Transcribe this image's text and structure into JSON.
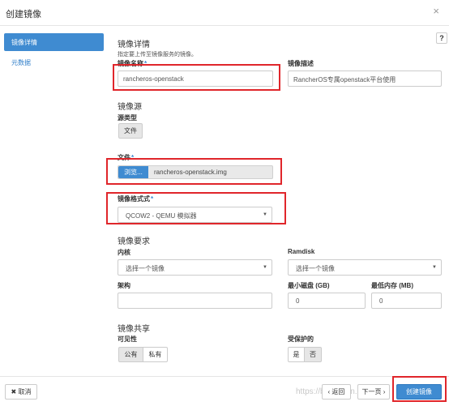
{
  "dialog": {
    "title": "创建镜像",
    "close_icon": "×"
  },
  "sidebar": {
    "items": [
      {
        "label": "镜像详情",
        "active": true
      },
      {
        "label": "元数据",
        "active": false
      }
    ]
  },
  "help_icon": "?",
  "details": {
    "section_title": "镜像详情",
    "hint": "指定要上传至镜像服务的镜像。",
    "name_label": "镜像名称",
    "name_value": "rancheros-openstack",
    "desc_label": "镜像描述",
    "desc_value": "RancherOS专属openstack平台使用"
  },
  "source": {
    "section_title": "镜像源",
    "type_label": "源类型",
    "type_button": "文件",
    "file_label": "文件",
    "browse_label": "浏览...",
    "file_name": "rancheros-openstack.img",
    "format_label": "镜像格式式",
    "format_value": "QCOW2 - QEMU 模拟器"
  },
  "requirements": {
    "section_title": "镜像要求",
    "kernel_label": "内核",
    "kernel_placeholder": "选择一个镜像",
    "ramdisk_label": "Ramdisk",
    "ramdisk_placeholder": "选择一个镜像",
    "arch_label": "架构",
    "arch_value": "",
    "min_disk_label": "最小磁盘 (GB)",
    "min_disk_value": "0",
    "min_ram_label": "最低内存 (MB)",
    "min_ram_value": "0"
  },
  "sharing": {
    "section_title": "镜像共享",
    "visibility_label": "可见性",
    "visibility_options": [
      "公有",
      "私有"
    ],
    "protected_label": "受保护的",
    "protected_options": [
      "是",
      "否"
    ]
  },
  "footer": {
    "cancel_label": "✖ 取消",
    "back_label": "‹ 返回",
    "next_label": "下一页 ›",
    "create_label": "创建镜像"
  },
  "watermark": "https://blog.csdn.net/..."
}
